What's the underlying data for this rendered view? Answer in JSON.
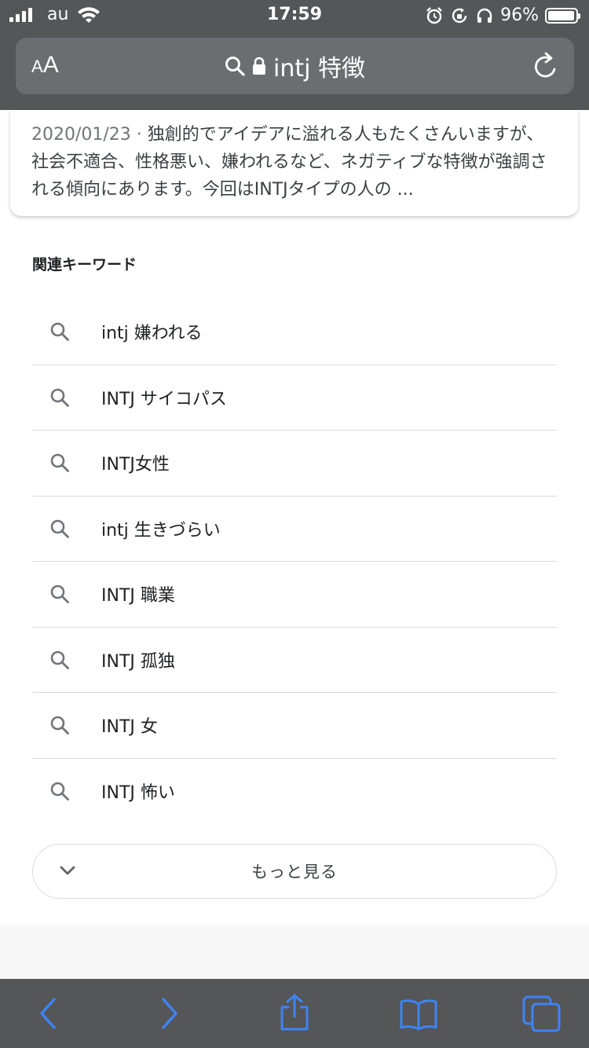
{
  "status_bar": {
    "carrier": "au",
    "time": "17:59",
    "battery_percent": "96%",
    "battery_level": 0.96
  },
  "url_bar": {
    "text_size_small": "A",
    "text_size_large": "A",
    "query": "intj 特徴"
  },
  "result": {
    "date": "2020/01/23",
    "separator": " · ",
    "snippet": "独創的でアイデアに溢れる人もたくさんいますが、社会不適合、性格悪い、嫌われるなど、ネガティブな特徴が強調される傾向にあります。今回はINTJタイプの人の ..."
  },
  "related": {
    "heading": "関連キーワード",
    "items": [
      "intj 嫌われる",
      "INTJ サイコパス",
      "INTJ女性",
      "intj 生きづらい",
      "INTJ 職業",
      "INTJ 孤独",
      "INTJ 女",
      "INTJ 怖い"
    ],
    "more_label": "もっと見る"
  },
  "colors": {
    "chrome": "#555658",
    "accent_blue": "#3d84f7",
    "divider": "#dadce0"
  }
}
